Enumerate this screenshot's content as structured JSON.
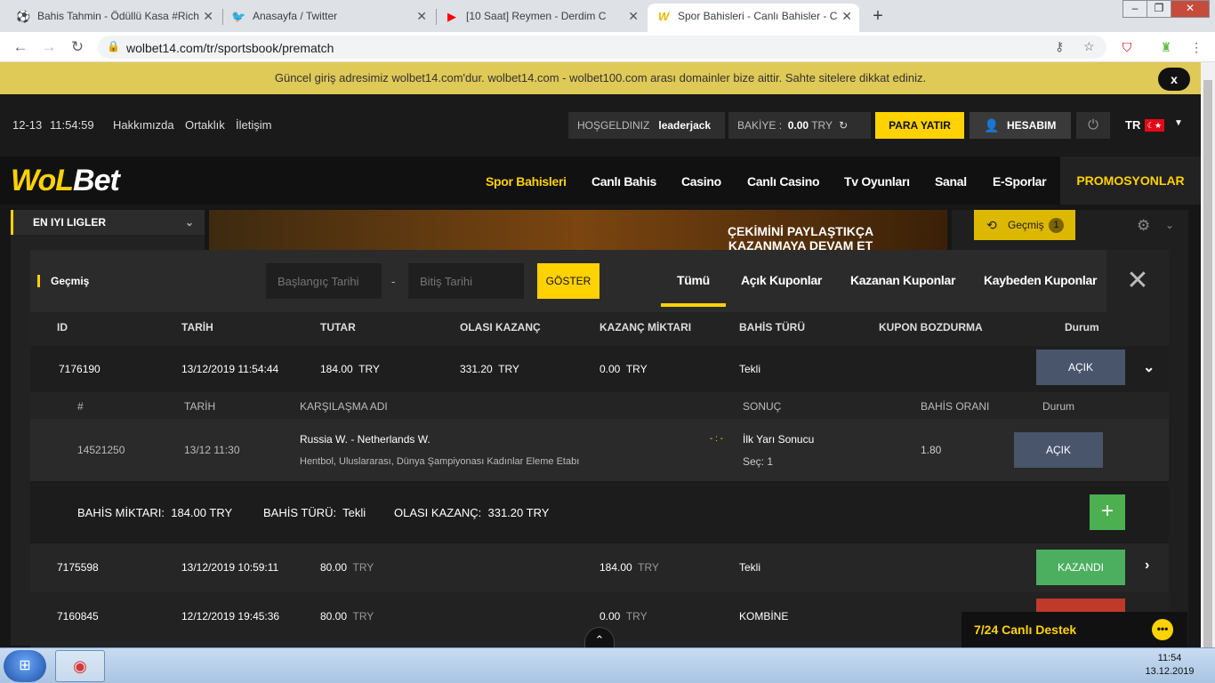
{
  "browser": {
    "tabs": [
      {
        "title": "Bahis Tahmin - Ödüllü Kasa #Rich",
        "icon": "soccer-ball-icon"
      },
      {
        "title": "Anasayfa / Twitter",
        "icon": "twitter-icon"
      },
      {
        "title": "[10 Saat] Reymen - Derdim C",
        "icon": "youtube-icon"
      },
      {
        "title": "Spor Bahisleri - Canlı Bahisler - C",
        "icon": "wolbet-icon"
      }
    ],
    "url": "wolbet14.com/tr/sportsbook/prematch"
  },
  "notice": {
    "text": "Güncel giriş adresimiz wolbet14.com'dur. wolbet14.com - wolbet100.com arası domainler bize aittir. Sahte sitelere dikkat ediniz.",
    "close": "x"
  },
  "topbar": {
    "date": "12-13",
    "time": "11:54:59",
    "links": [
      "Hakkımızda",
      "Ortaklık",
      "İletişim"
    ],
    "welcome_label": "HOŞGELDINIZ",
    "username": "leaderjack",
    "balance_label": "BAKİYE :",
    "balance_value": "0.00",
    "balance_currency": "TRY",
    "deposit": "PARA YATIR",
    "account": "HESABIM",
    "language": "TR"
  },
  "logo": {
    "wol": "WoL",
    "bet": "Bet"
  },
  "nav": {
    "items": [
      "Spor Bahisleri",
      "Canlı Bahis",
      "Casino",
      "Canlı Casino",
      "Tv Oyunları",
      "Sanal",
      "E-Sporlar"
    ],
    "promo": "PROMOSYONLAR"
  },
  "sidebar": {
    "title": "EN IYI LIGLER"
  },
  "banner": {
    "text": "ÇEKİMİNİ PAYLAŞTIKÇA KAZANMAYA DEVAM ET"
  },
  "rightpanel": {
    "history": "Geçmiş",
    "count": "1"
  },
  "modal": {
    "title": "Geçmiş",
    "start_placeholder": "Başlangıç Tarihi",
    "end_placeholder": "Bitiş Tarihi",
    "dash": "-",
    "show": "GÖSTER",
    "filters": [
      "Tümü",
      "Açık Kuponlar",
      "Kazanan Kuponlar",
      "Kaybeden Kuponlar"
    ],
    "columns": [
      "ID",
      "TARİH",
      "TUTAR",
      "OLASI KAZANÇ",
      "KAZANÇ MİKTARI",
      "BAHİS TÜRÜ",
      "KUPON BOZDURMA",
      "Durum"
    ],
    "rows": [
      {
        "id": "7176190",
        "date": "13/12/2019 11:54:44",
        "amount": "184.00",
        "currency": "TRY",
        "possible": "331.20",
        "possible_cur": "TRY",
        "won": "0.00",
        "won_cur": "TRY",
        "type": "Tekli",
        "status": "AÇIK"
      },
      {
        "id": "7175598",
        "date": "13/12/2019 10:59:11",
        "amount": "80.00",
        "currency": "TRY",
        "possible": "",
        "possible_cur": "",
        "won": "184.00",
        "won_cur": "TRY",
        "type": "Tekli",
        "status": "KAZANDI"
      },
      {
        "id": "7160845",
        "date": "12/12/2019 19:45:36",
        "amount": "80.00",
        "currency": "TRY",
        "possible": "",
        "possible_cur": "",
        "won": "0.00",
        "won_cur": "TRY",
        "type": "KOMBİNE",
        "status": ""
      }
    ],
    "detail": {
      "columns": [
        "#",
        "TARİH",
        "KARŞILAŞMA ADI",
        "SONUÇ",
        "BAHİS ORANI",
        "Durum"
      ],
      "row": {
        "no": "14521250",
        "date": "13/12 11:30",
        "match": "Russia W. - Netherlands W.",
        "league": "Hentbol, Uluslararası, Dünya Şampiyonası Kadınlar Eleme Etabı",
        "score": "- : -",
        "result": "İlk Yarı Sonucu",
        "pick": "Seç:  1",
        "odds": "1.80",
        "status": "AÇIK"
      }
    },
    "summary": {
      "amount_label": "BAHİS MİKTARI:",
      "amount_value": "184.00 TRY",
      "type_label": "BAHİS TÜRÜ:",
      "type_value": "Tekli",
      "possible_label": "OLASI KAZANÇ:",
      "possible_value": "331.20 TRY"
    }
  },
  "support": {
    "text": "7/24 Canlı Destek"
  },
  "taskbar": {
    "time": "11:54",
    "date": "13.12.2019"
  }
}
